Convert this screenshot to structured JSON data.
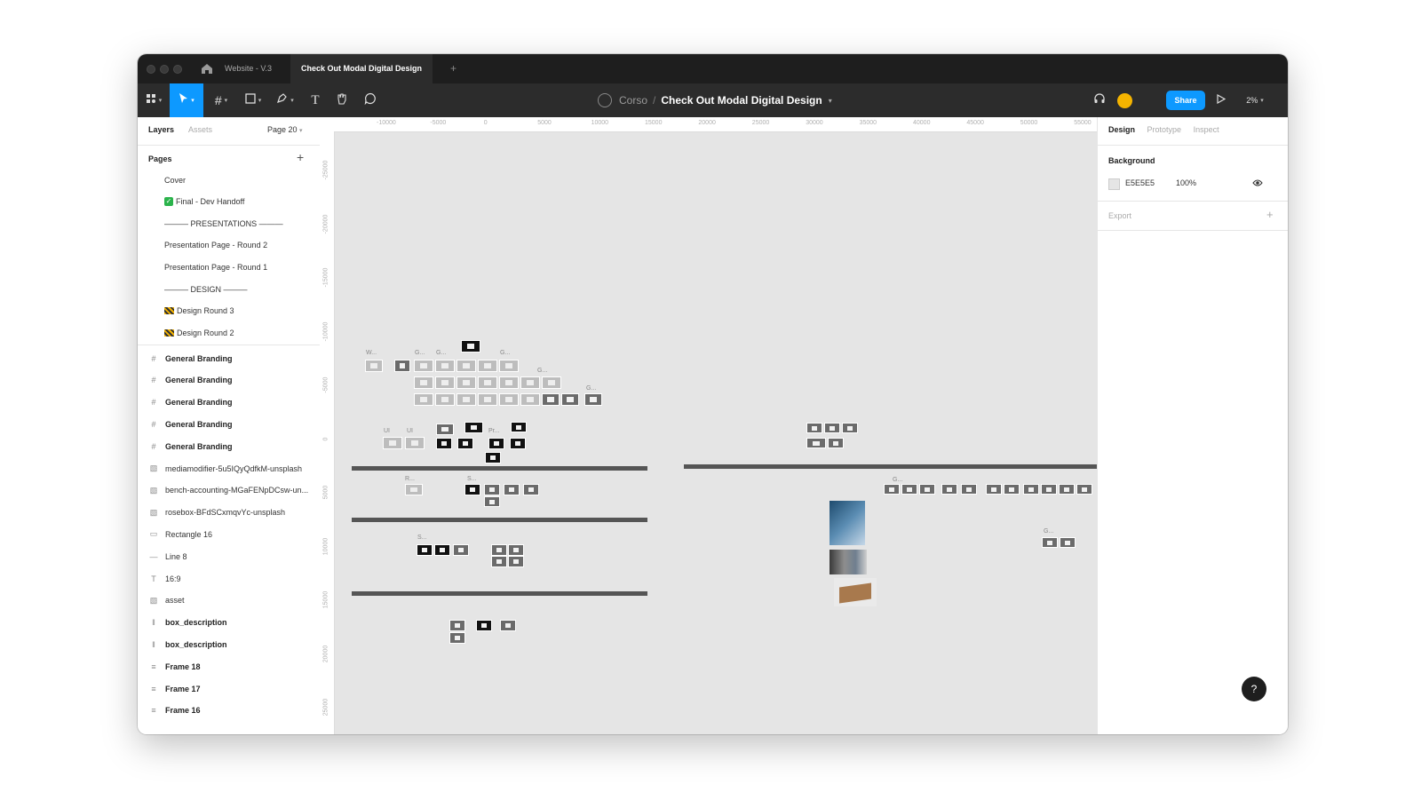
{
  "tabs": {
    "file1": "Website - V.3",
    "file2": "Check Out Modal Digital Design",
    "add": "+"
  },
  "toolbar": {
    "team": "Corso",
    "separator": "/",
    "file_title": "Check Out Modal Digital Design",
    "share_label": "Share",
    "zoom": "2%"
  },
  "left_panel": {
    "tab_layers": "Layers",
    "tab_assets": "Assets",
    "page_selector": "Page 20",
    "pages_heading": "Pages",
    "pages_add": "+",
    "pages": [
      "Cover",
      "Final - Dev Handoff",
      "——— PRESENTATIONS ———",
      "Presentation Page - Round 2",
      "Presentation Page - Round 1",
      "——— DESIGN ———",
      "Design Round 3",
      "Design Round 2"
    ],
    "layers": [
      {
        "name": "General Branding",
        "icon": "frame-icon",
        "bold": true
      },
      {
        "name": "General Branding",
        "icon": "frame-icon",
        "bold": true
      },
      {
        "name": "General Branding",
        "icon": "frame-icon",
        "bold": true
      },
      {
        "name": "General Branding",
        "icon": "frame-icon",
        "bold": true
      },
      {
        "name": "General Branding",
        "icon": "frame-icon",
        "bold": true
      },
      {
        "name": "mediamodifier-5u5IQyQdfkM-unsplash",
        "icon": "image-icon",
        "bold": false
      },
      {
        "name": "bench-accounting-MGaFENpDCsw-un...",
        "icon": "image-icon",
        "bold": false
      },
      {
        "name": "rosebox-BFdSCxmqvYc-unsplash",
        "icon": "image-icon",
        "bold": false
      },
      {
        "name": "Rectangle 16",
        "icon": "rectangle-icon",
        "bold": false
      },
      {
        "name": "Line 8",
        "icon": "line-icon",
        "bold": false
      },
      {
        "name": "16:9",
        "icon": "text-icon",
        "bold": false
      },
      {
        "name": "asset",
        "icon": "image-icon",
        "bold": false
      },
      {
        "name": "box_description",
        "icon": "auto-layout-columns-icon",
        "bold": true
      },
      {
        "name": "box_description",
        "icon": "auto-layout-columns-icon",
        "bold": true
      },
      {
        "name": "Frame 18",
        "icon": "auto-layout-rows-icon",
        "bold": true
      },
      {
        "name": "Frame 17",
        "icon": "auto-layout-rows-icon",
        "bold": true
      },
      {
        "name": "Frame 16",
        "icon": "auto-layout-rows-icon",
        "bold": true
      }
    ]
  },
  "ruler": {
    "top": [
      "-10000",
      "-5000",
      "0",
      "5000",
      "10000",
      "15000",
      "20000",
      "25000",
      "30000",
      "35000",
      "40000",
      "45000",
      "50000",
      "55000"
    ],
    "left": [
      "-25000",
      "-20000",
      "-15000",
      "-10000",
      "-5000",
      "0",
      "5000",
      "10000",
      "15000",
      "20000",
      "25000"
    ]
  },
  "canvas_labels": {
    "w": "W...",
    "g": "G...",
    "ui": "UI",
    "r": "R...",
    "s": "S...",
    "pr": "Pr..."
  },
  "right_panel": {
    "tab_design": "Design",
    "tab_prototype": "Prototype",
    "tab_inspect": "Inspect",
    "background_heading": "Background",
    "bg_hex": "E5E5E5",
    "bg_opacity": "100%",
    "export_label": "Export",
    "export_add": "+"
  },
  "colors": {
    "accent": "#0d99ff",
    "canvas_bg": "#E5E5E5",
    "chrome_dark": "#2c2c2c",
    "avatar": "#f5b400",
    "check_green": "#2bb34b"
  },
  "help_label": "?"
}
